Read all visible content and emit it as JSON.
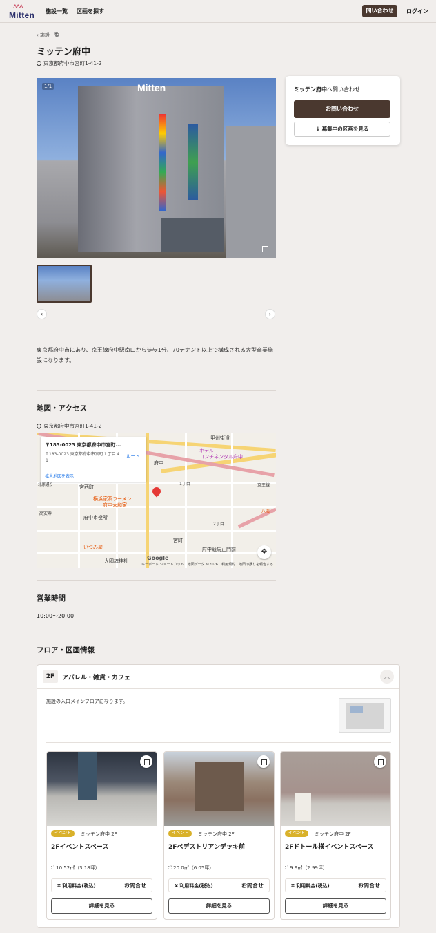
{
  "header": {
    "logo_text": "Mitten",
    "nav": [
      "施設一覧",
      "区画を探す"
    ],
    "contact": "問い合わせ",
    "login": "ログイン"
  },
  "breadcrumb": "施設一覧",
  "facility": {
    "name": "ミッテン府中",
    "address": "東京都府中市宮町1-41-2",
    "image_counter": "1/1",
    "building_sign": "Mitten",
    "description": "東京都府中市にあり、京王線府中駅南口から徒歩1分、70テナント以上で構成される大型商業施設になります。"
  },
  "contact_card": {
    "title_name": "ミッテン府中",
    "title_suffix": "へ問い合わせ",
    "primary": "お問い合わせ",
    "secondary": "↓ 募集中の区画を見る"
  },
  "access": {
    "heading": "地図・アクセス",
    "address": "東京都府中市宮町1-41-2",
    "map": {
      "box_title": "〒183-0023 東京都府中市宮町...",
      "box_address": "〒183-0023 東京都府中市宮町１丁目４１",
      "route": "ルート",
      "larger_map": "拡大地図を表示",
      "labels": [
        "甲州街道",
        "ホテル",
        "コンチネンタル府中",
        "府中",
        "横浜家系ラーメン",
        "府中大和家",
        "宮西町",
        "府中市役所",
        "1丁目",
        "2丁目",
        "宮町",
        "府中競馬正門前",
        "大國魂神社",
        "いづみ屋",
        "高安寺",
        "京王線",
        "北原通り",
        "八海"
      ],
      "footer": "キーボード ショートカット　地図データ ©2026　利用規約　地図の誤りを報告する",
      "google": "Google"
    }
  },
  "hours": {
    "heading": "営業時間",
    "value": "10:00〜20:00"
  },
  "floors": {
    "heading": "フロア・区画情報",
    "items": [
      {
        "badge": "2F",
        "name": "アパレル・雑貨・カフェ",
        "description": "施設の入口メインフロアになります。",
        "spaces": [
          {
            "tag": "イベント",
            "owner": "ミッテン府中 2F",
            "name": "2Fイベントスペース",
            "area": "10.52㎡（3.18坪）",
            "price_label": "¥ 利用料金(税込)",
            "price": "お問合せ",
            "detail": "詳細を見る"
          },
          {
            "tag": "イベント",
            "owner": "ミッテン府中 2F",
            "name": "2Fペデストリアンデッキ前",
            "area": "20.0㎡（6.05坪）",
            "price_label": "¥ 利用料金(税込)",
            "price": "お問合せ",
            "detail": "詳細を見る"
          },
          {
            "tag": "イベント",
            "owner": "ミッテン府中 2F",
            "name": "2Fドトール横イベントスペース",
            "area": "9.9㎡（2.99坪）",
            "price_label": "¥ 利用料金(税込)",
            "price": "お問合せ",
            "detail": "詳細を見る"
          }
        ]
      }
    ]
  },
  "colors": {
    "accent": "#4a382f",
    "background": "#f1eeec",
    "event_tag": "#d9b12a",
    "logo": "#2b2f6b"
  }
}
